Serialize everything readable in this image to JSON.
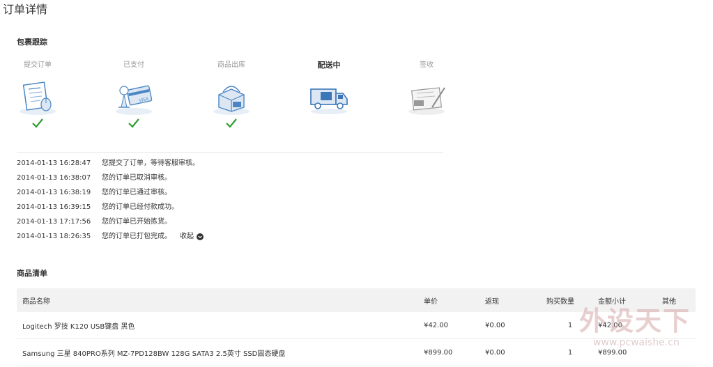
{
  "page": {
    "title": "订单详情"
  },
  "tracking": {
    "title": "包裹跟踪",
    "steps": [
      {
        "label": "提交订单",
        "icon": "order-form-icon",
        "done": true,
        "active": false
      },
      {
        "label": "已支付",
        "icon": "payment-card-icon",
        "done": true,
        "active": false
      },
      {
        "label": "商品出库",
        "icon": "package-box-icon",
        "done": true,
        "active": false
      },
      {
        "label": "配送中",
        "icon": "delivery-truck-icon",
        "done": false,
        "active": true
      },
      {
        "label": "签收",
        "icon": "signature-document-icon",
        "done": false,
        "active": false
      }
    ],
    "log": [
      {
        "time": "2014-01-13 16:28:47",
        "message": "您提交了订单，等待客服审核。"
      },
      {
        "time": "2014-01-13 16:38:07",
        "message": "您的订单已取消审核。"
      },
      {
        "time": "2014-01-13 16:38:19",
        "message": "您的订单已通过审核。"
      },
      {
        "time": "2014-01-13 16:39:15",
        "message": "您的订单已经付款成功。"
      },
      {
        "time": "2014-01-13 17:17:56",
        "message": "您的订单已开始拣货。"
      },
      {
        "time": "2014-01-13 18:26:35",
        "message": "您的订单已打包完成。"
      }
    ],
    "collapse_label": "收起"
  },
  "products": {
    "title": "商品清单",
    "columns": {
      "name": "商品名称",
      "price": "单价",
      "rebate": "返现",
      "qty": "购买数量",
      "total": "金额小计",
      "other": "其他"
    },
    "rows": [
      {
        "name": "Logitech 罗技 K120 USB键盘 黑色",
        "price": "¥42.00",
        "rebate": "¥0.00",
        "qty": "1",
        "total": "¥42.00",
        "other": ""
      },
      {
        "name": "Samsung 三星 840PRO系列 MZ-7PD128BW 128G SATA3 2.5英寸 SSD固态硬盘",
        "price": "¥899.00",
        "rebate": "¥0.00",
        "qty": "1",
        "total": "¥899.00",
        "other": ""
      }
    ]
  },
  "watermark": {
    "text": "外设天下",
    "url": "www.pcwaishe.cn"
  },
  "colors": {
    "check": "#2e9e2e",
    "icon_blue": "#4a86c5",
    "table_header_bg": "#f2f2f2"
  }
}
